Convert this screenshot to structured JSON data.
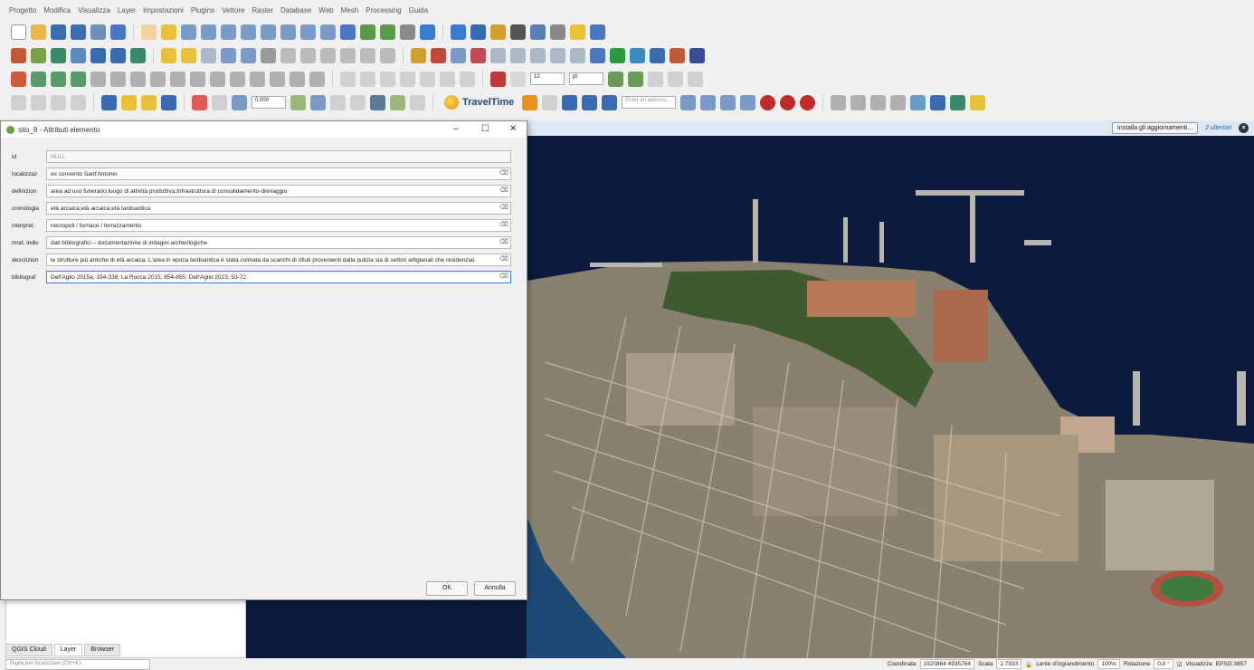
{
  "menu": [
    "Progetto",
    "Modifica",
    "Visualizza",
    "Layer",
    "Impostazioni",
    "Plugins",
    "Vettore",
    "Raster",
    "Database",
    "Web",
    "Mesh",
    "Processing",
    "Guida"
  ],
  "toolbar": {
    "traveltime_label": "TravelTime",
    "address_placeholder": "Enter an address...",
    "font_size_value": "12",
    "unit_value": "pt",
    "scale_value": "0,000"
  },
  "message_bar": {
    "install_label": "Installa gli aggiornamenti...",
    "more_label": "2 ulteriori"
  },
  "dialog": {
    "title": "sito_8 - Attributi elemento",
    "ok_label": "OK",
    "cancel_label": "Annulla",
    "fields": [
      {
        "label": "id",
        "value": "NULL"
      },
      {
        "label": "localizzaz",
        "value": "ex convento Sant'Antonio"
      },
      {
        "label": "definizion",
        "value": "area ad uso funerario;luogo di attività produttiva;Infrastruttura di consolidamento-drenaggio"
      },
      {
        "label": "cronologia",
        "value": "età arcaica;età arcaica;età tardoantica"
      },
      {
        "label": "interpret.",
        "value": "necropoli / fornace / terrazzamento"
      },
      {
        "label": "mod. indiv",
        "value": "dati bibliografici – documentazione di indagini archeologiche"
      },
      {
        "label": "descrizion",
        "value": "le strutture più antiche di età arcaica. L'area in epoca tardoantica è stata colmata da scarichi di rifiuti provenienti dalla pulizia sia di settori artigianali che residenzial."
      },
      {
        "label": "bibliograf",
        "value": "Dell'Aglio 2015a, 334-338; La Rocca 2015, 854-855; Dell'Aglio 2023, 53-72."
      }
    ]
  },
  "panel_tabs": [
    "QGIS Cloud",
    "Layer",
    "Browser"
  ],
  "locator_placeholder": "Digita per localizzare (Ctrl+K)",
  "status": {
    "coord_label": "Coordinata",
    "coord_value": "1920864  4935764",
    "scale_label": "Scala",
    "scale_value": "1:7933",
    "magnifier_label": "Lente d'ingrandimento",
    "magnifier_value": "100%",
    "rotation_label": "Rotazione",
    "rotation_value": "0,0 °",
    "render_label": "Visualizza",
    "crs_label": "EPSG:3857"
  }
}
